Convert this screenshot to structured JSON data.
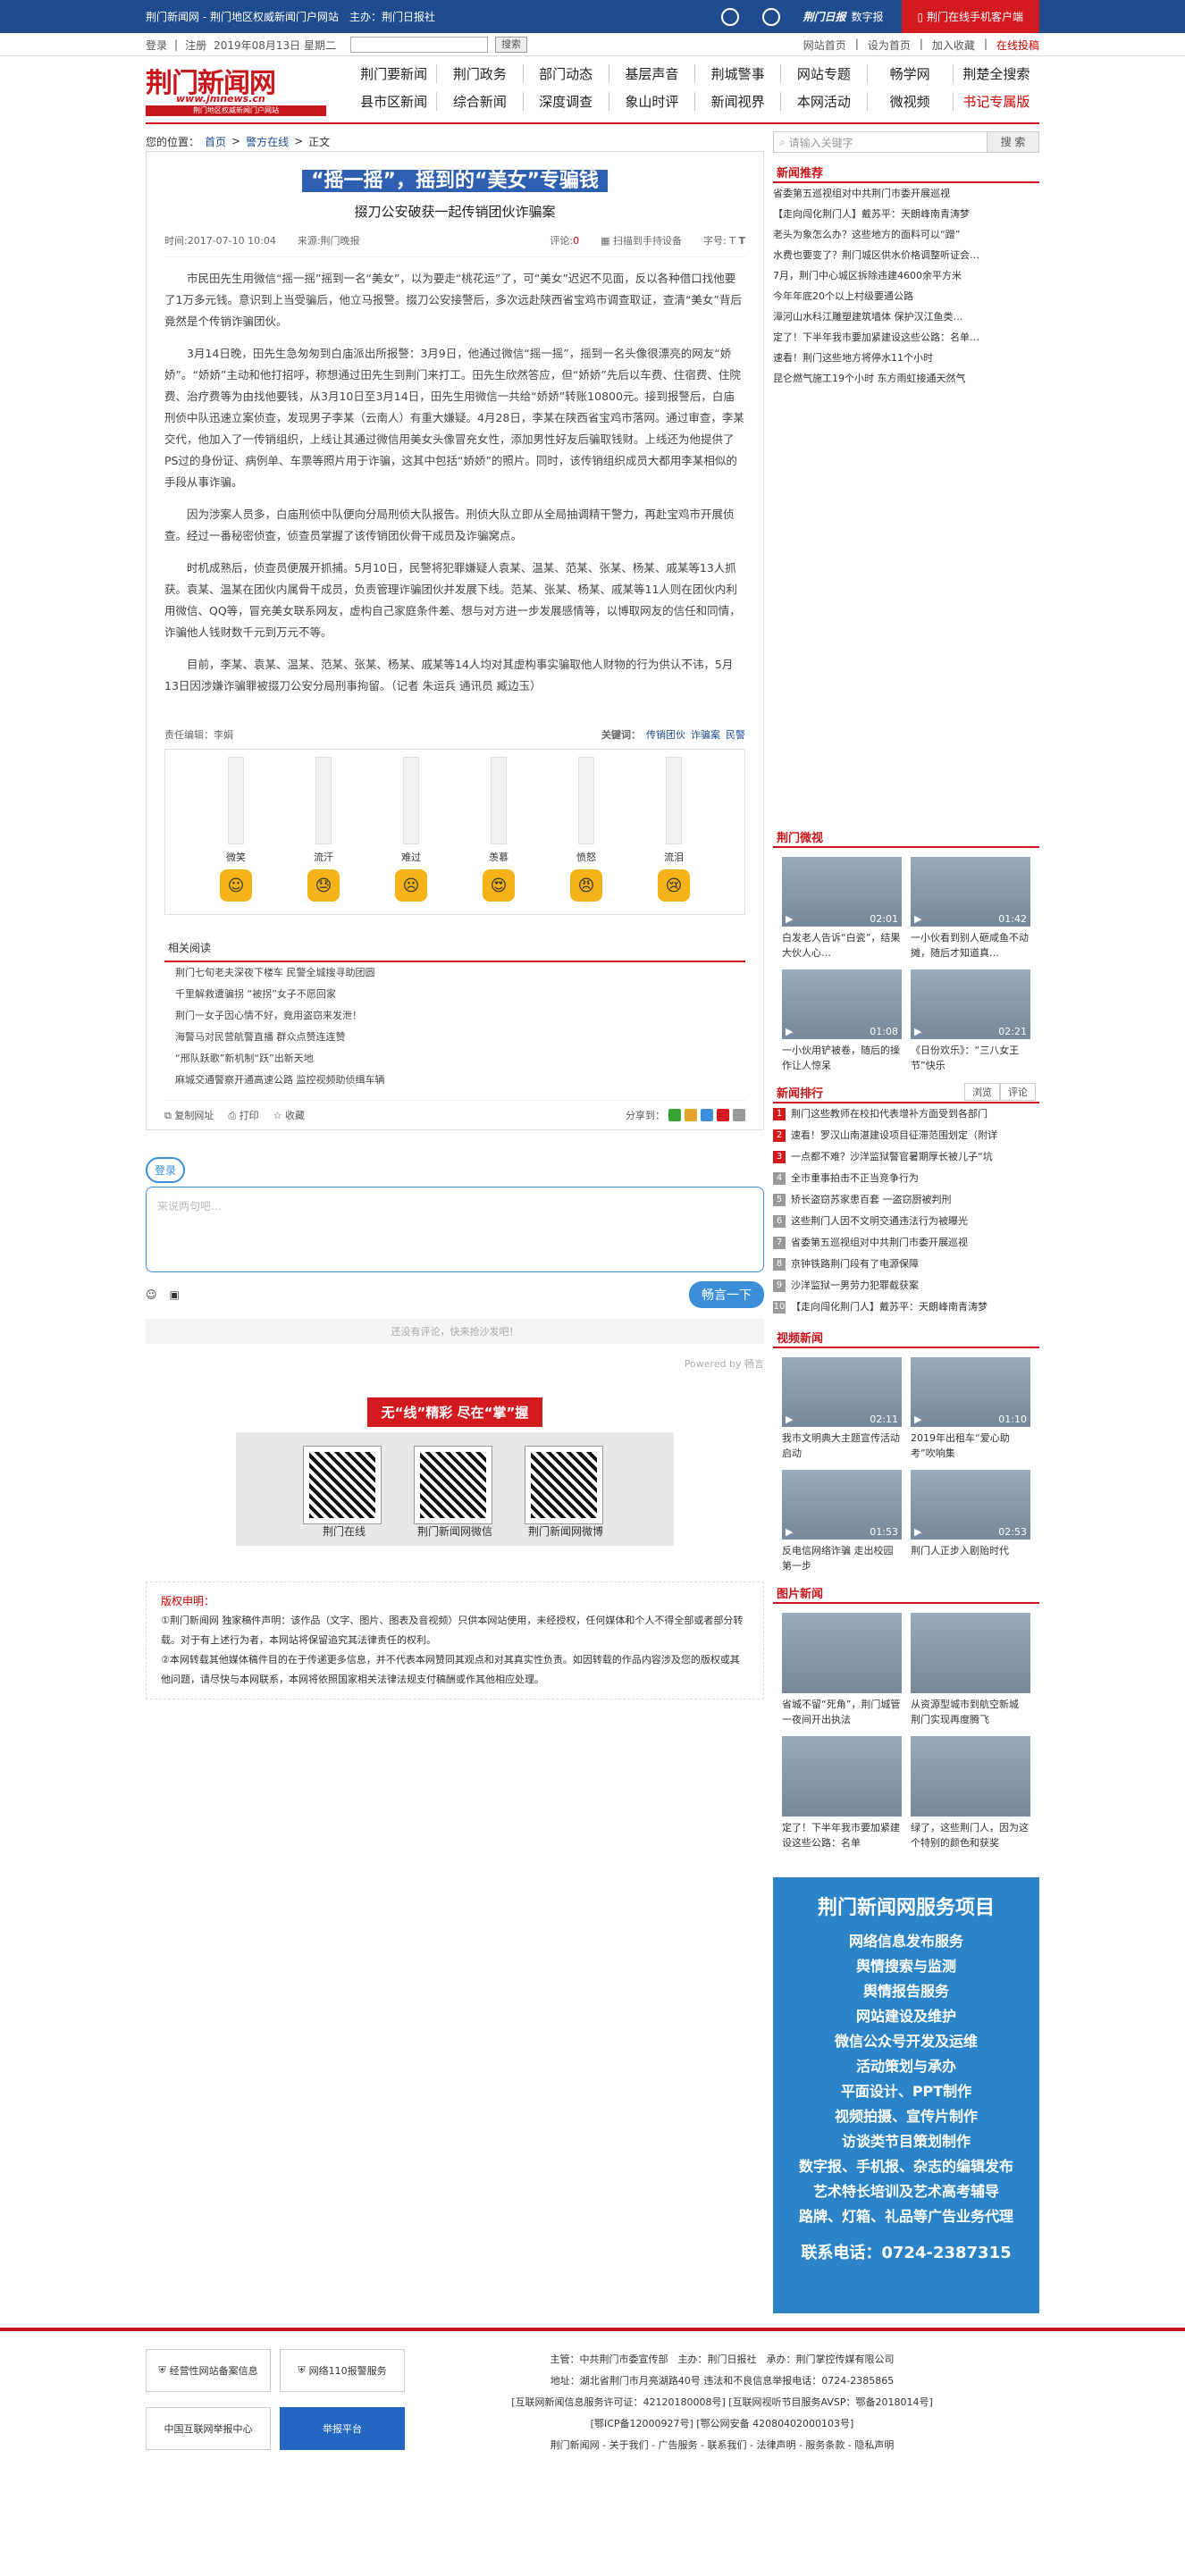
{
  "topbar": {
    "title": "荆门新闻网 - 荆门地区权威新闻门户网站　主办：荆门日报社",
    "weixin": "",
    "weibo": "",
    "digital": "数字报",
    "app": "荆门在线手机客户端"
  },
  "subbar": {
    "login": "登录",
    "reg": "注册",
    "date": "2019年08月13日  星期二",
    "search_btn": "搜索",
    "links": [
      "网站首页",
      "设为首页",
      "加入收藏",
      "在线投稿"
    ]
  },
  "logo": {
    "text": "荆门新闻网",
    "url": "www.jmnews.cn",
    "slogan": "荆门地区权威新闻门户网站"
  },
  "nav": [
    "荆门要新闻",
    "荆门政务",
    "部门动态",
    "基层声音",
    "荆城警事",
    "网站专题",
    "畅学网",
    "荆楚全搜索",
    "县市区新闻",
    "综合新闻",
    "深度调查",
    "象山时评",
    "新闻视界",
    "本网活动",
    "微视频",
    "书记专属版"
  ],
  "crumb": {
    "label": "您的位置：",
    "home": "首页",
    "section": "警方在线",
    "current": "正文"
  },
  "search": {
    "placeholder": "请输入关键字",
    "btn": "搜 索"
  },
  "article": {
    "title": "“摇一摇”，摇到的“美女”专骗钱",
    "subtitle": "掇刀公安破获一起传销团伙诈骗案",
    "time": "时间:2017-07-10 10:04",
    "source": "来源:荆门晚报",
    "comments_label": "评论:",
    "comments": "0",
    "scan": "扫描到手持设备",
    "font": "字号:",
    "paras": [
      "市民田先生用微信“摇一摇”摇到一名“美女”，以为要走“桃花运”了，可“美女”迟迟不见面，反以各种借口找他要了1万多元钱。意识到上当受骗后，他立马报警。掇刀公安接警后，多次远赴陕西省宝鸡市调查取证，查清“美女”背后竟然是个传销诈骗团伙。",
      "3月14日晚，田先生急匆匆到白庙派出所报警：3月9日，他通过微信“摇一摇”，摇到一名头像很漂亮的网友“娇娇”。“娇娇”主动和他打招呼，称想通过田先生到荆门来打工。田先生欣然答应，但“娇娇”先后以车费、住宿费、住院费、治疗费等为由找他要钱，从3月10日至3月14日，田先生用微信一共给“娇娇”转账10800元。接到报警后，白庙刑侦中队迅速立案侦查，发现男子李某（云南人）有重大嫌疑。4月28日，李某在陕西省宝鸡市落网。通过审查，李某交代，他加入了一传销组织，上线让其通过微信用美女头像冒充女性，添加男性好友后骗取钱财。上线还为他提供了PS过的身份证、病例单、车票等照片用于诈骗，这其中包括“娇娇”的照片。同时，该传销组织成员大都用李某相似的手段从事诈骗。",
      "因为涉案人员多，白庙刑侦中队便向分局刑侦大队报告。刑侦大队立即从全局抽调精干警力，再赴宝鸡市开展侦查。经过一番秘密侦查，侦查员掌握了该传销团伙骨干成员及诈骗窝点。",
      "时机成熟后，侦查员便展开抓捕。5月10日，民警将犯罪嫌疑人袁某、温某、范某、张某、杨某、戚某等13人抓获。袁某、温某在团伙内属骨干成员，负责管理诈骗团伙并发展下线。范某、张某、杨某、戚某等11人则在团伙内利用微信、QQ等，冒充美女联系网友，虚构自己家庭条件差、想与对方进一步发展感情等，以博取网友的信任和同情，诈骗他人钱财数千元到万元不等。",
      "目前，李某、袁某、温某、范某、张某、杨某、戚某等14人均对其虚构事实骗取他人财物的行为供认不讳，5月13日因涉嫌诈骗罪被掇刀公安分局刑事拘留。（记者 朱运兵 通讯员 臧边玉）"
    ],
    "editor": "责任编辑：李娟",
    "keywords_label": "关键词：",
    "keywords": [
      "传销团伙",
      "诈骗案",
      "民警"
    ]
  },
  "mood": [
    {
      "label": "微笑",
      "face": "☺"
    },
    {
      "label": "流汗",
      "face": "😓"
    },
    {
      "label": "难过",
      "face": "☹"
    },
    {
      "label": "羡慕",
      "face": "😍"
    },
    {
      "label": "愤怒",
      "face": "😠"
    },
    {
      "label": "流泪",
      "face": "😢"
    }
  ],
  "related": {
    "title": "相关阅读",
    "items": [
      "荆门七旬老夫深夜下楼车 民警全城搜寻助团圆",
      "千里解救遭骗拐 “被拐”女子不愿回家",
      "荆门一女子因心情不好，竟用盗窃来发泄！",
      "海警马对民营航警直播 群众点赞连连赞",
      "“邢队跃歌”新机制“跃”出新天地",
      "麻城交通警察开通高速公路 监控视频助侦缉车辆"
    ]
  },
  "tools": {
    "copy": "复制网址",
    "print": "打印",
    "fav": "收藏",
    "share": "分享到："
  },
  "comment": {
    "login": "登录",
    "placeholder": "来说两句吧…",
    "send": "畅言一下",
    "none": "还没有评论，快来抢沙发吧！",
    "powered": "Powered by 畅言"
  },
  "qr": {
    "tag": "无“线”精彩 尽在“掌”握",
    "items": [
      "荆门在线",
      "荆门新闻网微信",
      "荆门新闻网微博"
    ]
  },
  "copyright": {
    "title": "版权申明：",
    "l1": "①荆门新闻网 独家稿件声明：该作品（文字、图片、图表及音视频）只供本网站使用，未经授权，任何媒体和个人不得全部或者部分转载。对于有上述行为者，本网站将保留追究其法律责任的权利。",
    "l2": "②本网转载其他媒体稿件目的在于传递更多信息，并不代表本网赞同其观点和对其真实性负责。如因转载的作品内容涉及您的版权或其他问题，请尽快与本网联系，本网将依照国家相关法律法规支付稿酬或作其他相应处理。"
  },
  "side": {
    "rec_title": "新闻推荐",
    "rec": [
      "省委第五巡视组对中共荆门市委开展巡视",
      "【走向闯化荆门人】戴苏平：天朗峰南青涛梦",
      "老头为象怎么办？这些地方的面料可以“蹭”",
      "水费也要变了？荆门城区供水价格调整听证会…",
      "7月，荆门中心城区拆除违建4600余平方米",
      "今年年底20个以上村级要通公路",
      "漳河山水科江雕塑建筑墙体 保护汉江鱼类…",
      "定了！下半年我市要加紧建设这些公路：名单…",
      "速看！荆门这些地方将停水11个小时",
      "昆仑燃气施工19个小时 东方雨虹接通天然气"
    ],
    "video_title": "荆门微视",
    "videos": [
      {
        "cap": "白发老人告诉“白瓷”，结果大伙人心…",
        "dur": "02:01"
      },
      {
        "cap": "一小伙看到别人砸咸鱼不动摊，随后才知道真…",
        "dur": "01:42"
      },
      {
        "cap": "一小伙用铲被卷，随后的操作让人惊呆",
        "dur": "01:08"
      },
      {
        "cap": "《日份欢乐》：“三八女王节”快乐",
        "dur": "02:21"
      }
    ],
    "rank_title": "新闻排行",
    "rank_tabs": [
      "浏览",
      "评论"
    ],
    "rank": [
      "荆门这些教师在校扣代表增补方面受到各部门",
      "速看！罗汉山南湛建设项目征滞范围划定（附详",
      "一点都不难？沙洋监狱警官暑期厚长被儿子“坑",
      "全市重事拍击不正当竞争行为",
      "矫长盗窃苏家患百套 一盗窃厨被判刑",
      "这些荆门人因不文明交通违法行为被曝光",
      "省委第五巡视组对中共荆门市委开展巡视",
      "京钟铁路荆门段有了电源保障",
      "沙洋监狱一男劳力犯罪截获案",
      "【走向闯化荆门人】戴苏平：天朗峰南青涛梦"
    ],
    "vnews_title": "视频新闻",
    "vnews": [
      {
        "cap": "我市文明典大主题宣传活动启动",
        "dur": "02:11"
      },
      {
        "cap": "2019年出租车“爱心助考”吹响集",
        "dur": "01:10"
      },
      {
        "cap": "反电信网络诈骗 走出校园第一步",
        "dur": "01:53"
      },
      {
        "cap": "荆门人正步入剧贻时代",
        "dur": "02:53"
      }
    ],
    "pic_title": "图片新闻",
    "pics": [
      "省城不留“死角”，荆门城管一夜间开出执法",
      "从资源型城市到航空新城 荆门实现再度腾飞",
      "定了！下半年我市要加紧建设这些公路：名单",
      "绿了，这些荆门人，因为这个特别的颜色和获奖"
    ],
    "ad_title": "荆门新闻网服务项目",
    "ad_lines": [
      "网络信息发布服务",
      "舆情搜索与监测",
      "舆情报告服务",
      "网站建设及维护",
      "微信公众号开发及运维",
      "活动策划与承办",
      "平面设计、PPT制作",
      "视频拍摄、宣传片制作",
      "访谈类节目策划制作",
      "数字报、手机报、杂志的编辑发布",
      "艺术特长培训及艺术高考辅导",
      "路牌、灯箱、礼品等广告业务代理"
    ],
    "ad_tel": "联系电话：0724-2387315"
  },
  "footer": {
    "badges": [
      "经营性网站备案信息",
      "网络110报警服务",
      "中国互联网举报中心",
      "举报平台"
    ],
    "lines": [
      "主管：中共荆门市委宣传部　主办：荆门日报社　承办：荆门掌控传媒有限公司",
      "地址：湖北省荆门市月亮湖路40号 违法和不良信息举报电话：0724-2385865",
      "[互联网新闻信息服务许可证：42120180008号] [互联网视听节目服务AVSP：鄂备2018014号]",
      "[鄂ICP备12000927号] [鄂公网安备 42080402000103号]",
      "荆门新闻网 - 关于我们 - 广告服务 - 联系我们 - 法律声明 - 服务条款 - 隐私声明"
    ]
  }
}
